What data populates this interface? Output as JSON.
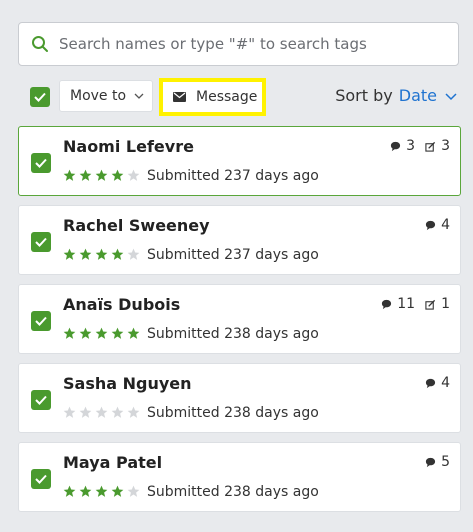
{
  "search": {
    "placeholder": "Search names or type \"#\" to search tags"
  },
  "toolbar": {
    "move_to_label": "Move to",
    "message_label": "Message",
    "sort_label": "Sort by",
    "sort_value": "Date"
  },
  "colors": {
    "accent": "#1f73d0",
    "check": "#4a9a2e",
    "star": "#4a9a2e",
    "highlight": "#fff200"
  },
  "icons": [
    "search-icon",
    "check-icon",
    "chevron-down-icon",
    "mail-icon",
    "comment-icon",
    "edit-icon",
    "star-icon"
  ],
  "cards": [
    {
      "name": "Naomi Lefevre",
      "rating": 4,
      "submitted": "Submitted 237 days ago",
      "comments": "3",
      "edits": "3",
      "selected": true
    },
    {
      "name": "Rachel Sweeney",
      "rating": 4,
      "submitted": "Submitted 237 days ago",
      "comments": "4",
      "edits": null,
      "selected": false
    },
    {
      "name": "Anaïs Dubois",
      "rating": 5,
      "submitted": "Submitted 238 days ago",
      "comments": "11",
      "edits": "1",
      "selected": false
    },
    {
      "name": "Sasha Nguyen",
      "rating": 0,
      "submitted": "Submitted 238 days ago",
      "comments": "4",
      "edits": null,
      "selected": false
    },
    {
      "name": "Maya Patel",
      "rating": 4,
      "submitted": "Submitted 238 days ago",
      "comments": "5",
      "edits": null,
      "selected": false
    }
  ]
}
